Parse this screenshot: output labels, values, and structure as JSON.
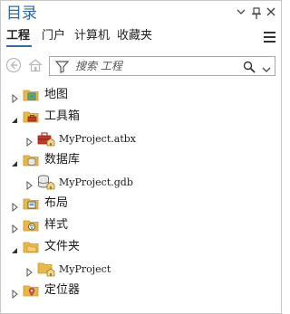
{
  "pane": {
    "title": "目录",
    "buttons": {
      "dropdown": "▾",
      "pin": "📌",
      "close": "✕"
    }
  },
  "tabs": [
    {
      "label": "工程",
      "active": true
    },
    {
      "label": "门户",
      "active": false
    },
    {
      "label": "计算机",
      "active": false
    },
    {
      "label": "收藏夹",
      "active": false
    }
  ],
  "search": {
    "placeholder": "搜索 工程",
    "value": ""
  },
  "colors": {
    "accent": "#2d6aa8",
    "folder": "#e8b84a",
    "folder_dark": "#c9962a"
  },
  "tree": [
    {
      "label": "地图",
      "state": "collapsed",
      "icon": "maps-folder-icon"
    },
    {
      "label": "工具箱",
      "state": "expanded",
      "icon": "toolboxes-folder-icon"
    },
    {
      "label": "MyProject.atbx",
      "state": "collapsed",
      "icon": "toolbox-icon"
    },
    {
      "label": "数据库",
      "state": "expanded",
      "icon": "databases-folder-icon"
    },
    {
      "label": "MyProject.gdb",
      "state": "collapsed",
      "icon": "geodatabase-icon"
    },
    {
      "label": "布局",
      "state": "collapsed",
      "icon": "layouts-folder-icon"
    },
    {
      "label": "样式",
      "state": "collapsed",
      "icon": "styles-folder-icon"
    },
    {
      "label": "文件夹",
      "state": "expanded",
      "icon": "folders-folder-icon"
    },
    {
      "label": "MyProject",
      "state": "collapsed",
      "icon": "home-folder-icon"
    },
    {
      "label": "定位器",
      "state": "collapsed",
      "icon": "locators-folder-icon"
    }
  ]
}
